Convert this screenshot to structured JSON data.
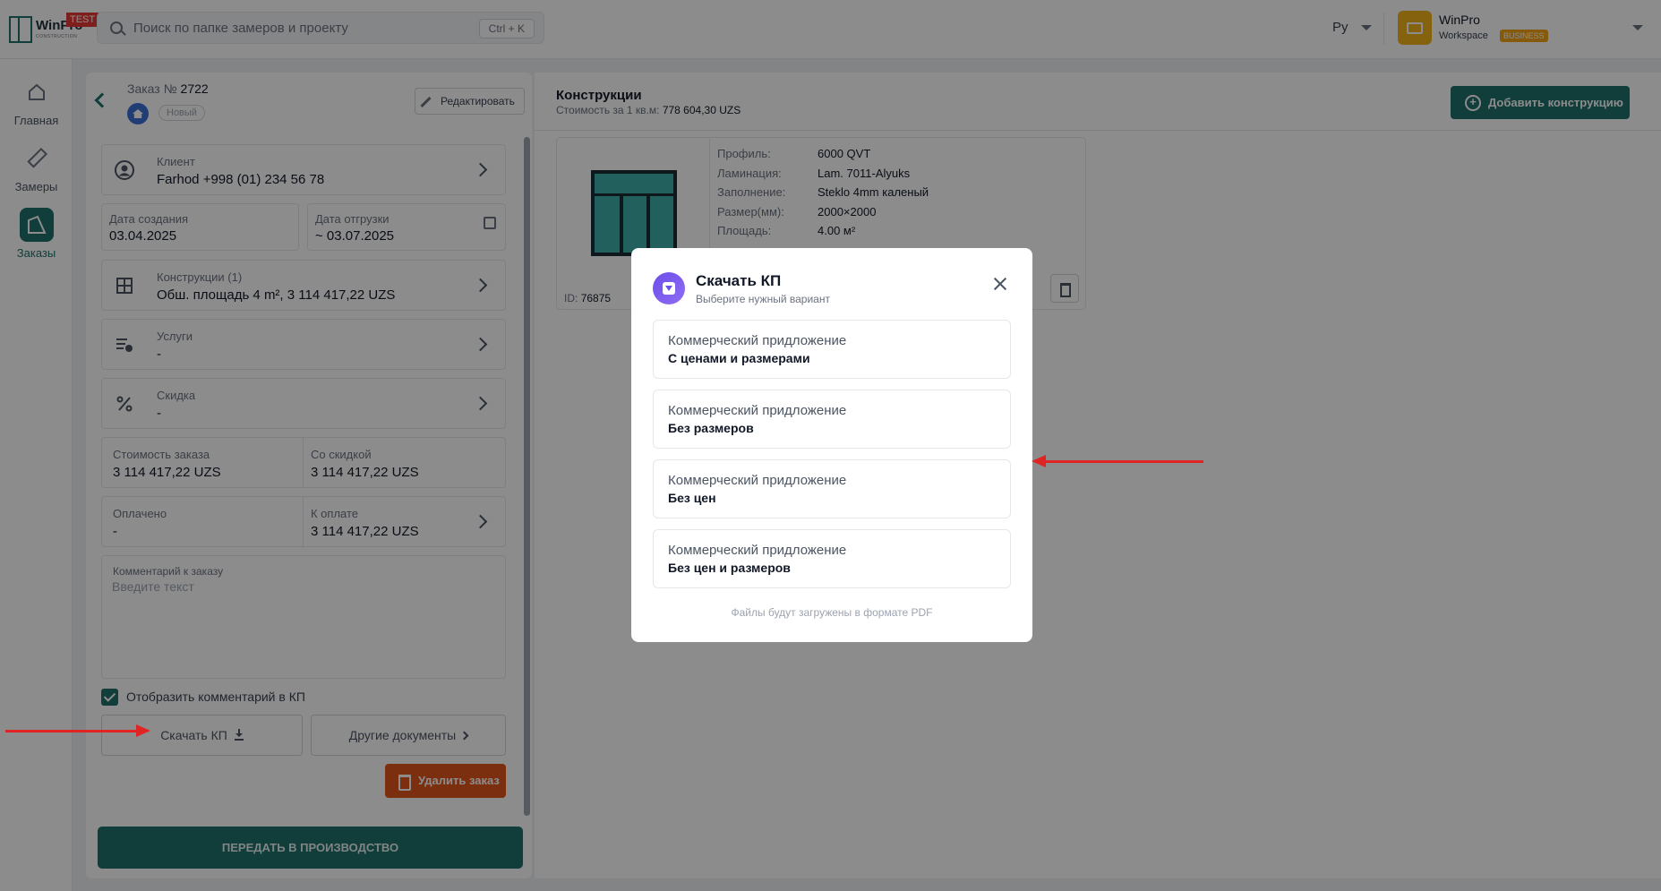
{
  "topbar": {
    "logo_text": "WinPro",
    "logo_sub": "CONSTRUCTION",
    "test_badge": "TEST",
    "search_placeholder": "Поиск по папке замеров и проекту",
    "search_shortcut": "Ctrl + K",
    "language": "Ру",
    "workspace_name": "WinPro",
    "workspace_sub": "Workspace",
    "workspace_badge": "BUSINESS"
  },
  "sidebar": {
    "items": [
      {
        "label": "Главная",
        "icon": "home-icon"
      },
      {
        "label": "Замеры",
        "icon": "ruler-icon"
      },
      {
        "label": "Заказы",
        "icon": "orders-icon",
        "active": true
      }
    ]
  },
  "order": {
    "title_prefix": "Заказ №",
    "number": "2722",
    "status": "Новый",
    "edit_label": "Редактировать",
    "client_label": "Клиент",
    "client_value": "Farhod +998 (01) 234 56 78",
    "created_label": "Дата создания",
    "created_value": "03.04.2025",
    "shipping_label": "Дата отгрузки",
    "shipping_value": "~ 03.07.2025",
    "constructions_label": "Конструкции (1)",
    "constructions_value": "Обш. площадь 4 m²,  3 114 417,22 UZS",
    "services_label": "Услуги",
    "services_value": "-",
    "discount_label": "Скидка",
    "discount_value": "-",
    "cost_label": "Стоимость заказа",
    "cost_value": "3 114 417,22 UZS",
    "with_discount_label": "Со скидкой",
    "with_discount_value": "3 114 417,22 UZS",
    "paid_label": "Оплачено",
    "paid_value": "-",
    "to_pay_label": "К оплате",
    "to_pay_value": "3 114 417,22 UZS",
    "comment_label": "Комментарий к заказу",
    "comment_placeholder": "Введите текст",
    "show_comment_label": "Отобразить комментарий в КП",
    "show_comment_checked": true,
    "download_kp_label": "Скачать КП",
    "other_docs_label": "Другие документы",
    "delete_label": "Удалить заказ",
    "produce_label": "ПЕРЕДАТЬ В ПРОИЗВОДСТВО"
  },
  "constructions": {
    "title": "Конструкции",
    "price_label": "Стоимость за 1 кв.м:",
    "price_value": "778 604,30 UZS",
    "add_label": "Добавить конструкцию",
    "card": {
      "id_label": "ID:",
      "id_value": "76875",
      "specs": [
        {
          "key": "Профиль:",
          "value": "6000 QVT"
        },
        {
          "key": "Ламинация:",
          "value": "Lam. 7011-Alyuks"
        },
        {
          "key": "Заполнение:",
          "value": "Steklo 4mm каленый"
        },
        {
          "key": "Размер(мм):",
          "value": "2000×2000"
        },
        {
          "key": "Площадь:",
          "value": "4.00 м²"
        }
      ]
    }
  },
  "modal": {
    "title": "Скачать КП",
    "subtitle": "Выберите нужный вариант",
    "options": [
      {
        "line1": "Коммерческий придложение",
        "line2": "С ценами и размерами"
      },
      {
        "line1": "Коммерческий придложение",
        "line2": "Без размеров"
      },
      {
        "line1": "Коммерческий придложение",
        "line2": "Без цен"
      },
      {
        "line1": "Коммерческий придложение",
        "line2": "Без цен и размеров"
      }
    ],
    "footer": "Файлы будут загружены в формате PDF"
  },
  "colors": {
    "accent": "#1f6f6b",
    "danger": "#e2571c",
    "annotation_arrow": "#e02424"
  }
}
